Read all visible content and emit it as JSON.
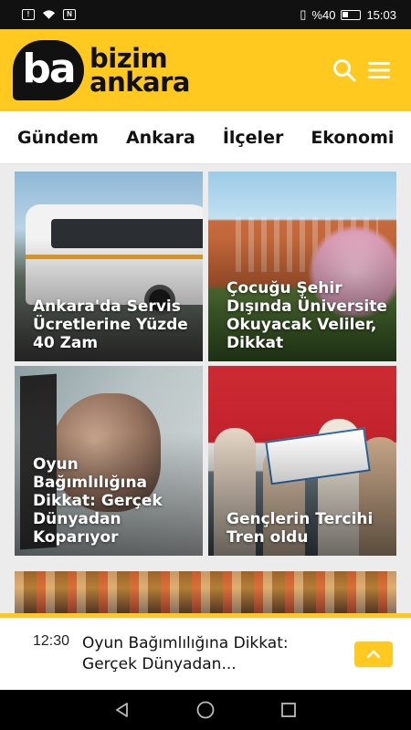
{
  "status_bar": {
    "battery_percent": "%40",
    "time": "15:03"
  },
  "header": {
    "logo_mark": "ba",
    "logo_line1": "bizim",
    "logo_line2": "ankara",
    "brand_color": "#ffc91f"
  },
  "categories": [
    "Gündem",
    "Ankara",
    "İlçeler",
    "Ekonomi"
  ],
  "cards": [
    {
      "title": "Ankara'da Servis Ücretlerine Yüzde 40 Zam"
    },
    {
      "title": "Çocuğu Şehir Dışında Üniversite Okuyacak Veliler, Dikkat"
    },
    {
      "title": "Oyun Bağımlılığına Dikkat: Gerçek Dünyadan Koparıyor"
    },
    {
      "title": "Gençlerin Tercihi Tren oldu"
    }
  ],
  "ticker": {
    "time": "12:30",
    "text": "Oyun Bağımlılığına Dikkat: Gerçek Dünyadan..."
  }
}
